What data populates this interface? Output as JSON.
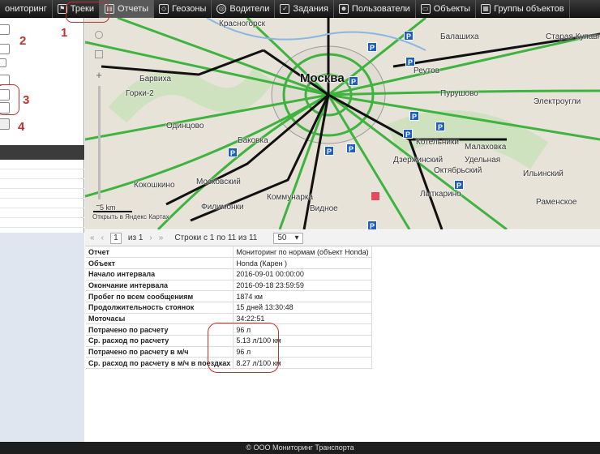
{
  "nav": [
    {
      "label": "ониторинг",
      "icon": "monitor-icon"
    },
    {
      "label": "Треки",
      "icon": "flag-icon"
    },
    {
      "label": "Отчеты",
      "icon": "report-icon",
      "active": true
    },
    {
      "label": "Геозоны",
      "icon": "geozone-icon"
    },
    {
      "label": "Водители",
      "icon": "steering-wheel-icon"
    },
    {
      "label": "Задания",
      "icon": "task-icon"
    },
    {
      "label": "Пользователи",
      "icon": "user-icon"
    },
    {
      "label": "Объекты",
      "icon": "bus-icon"
    },
    {
      "label": "Группы объектов",
      "icon": "groups-icon"
    }
  ],
  "annotations": [
    "1",
    "2",
    "3",
    "4"
  ],
  "map": {
    "city": "Москва",
    "labels": [
      "Красногорск",
      "Балашиха",
      "Старая Купавна",
      "Реутов",
      "Электроугли",
      "Одинцово",
      "Пурушово",
      "Баковка",
      "Котельники",
      "Малаховка",
      "Дзержинский",
      "Удельная",
      "Лыткарино",
      "Ильинский",
      "Раменское",
      "Видное",
      "Коммунарка",
      "Кокошкино",
      "Московский",
      "Филимонки",
      "Горки-2",
      "Барвиха",
      "Октябрьский"
    ],
    "scale": "5 km",
    "open_link": "Открыть в Яндекс Картах"
  },
  "pager": {
    "page": "1",
    "of_pages": "из 1",
    "rows_info": "Строки с 1 по 11 из 11",
    "page_size": "50"
  },
  "report": [
    {
      "key": "Отчет",
      "value": "Мониторинг по нормам (объект Honda)"
    },
    {
      "key": "Объект",
      "value": "Honda (Карен )"
    },
    {
      "key": "Начало интервала",
      "value": "2016-09-01 00:00:00"
    },
    {
      "key": "Окончание интервала",
      "value": "2016-09-18 23:59:59"
    },
    {
      "key": "Пробег по всем сообщениям",
      "value": "1874 км"
    },
    {
      "key": "Продолжительность стоянок",
      "value": "15 дней 13:30:48"
    },
    {
      "key": "Моточасы",
      "value": "34:22:51"
    },
    {
      "key": "Потрачено по расчету",
      "value": "96 л"
    },
    {
      "key": "Ср. расход по расчету",
      "value": "5.13 л/100 км"
    },
    {
      "key": "Потрачено по расчету в м/ч",
      "value": "96 л"
    },
    {
      "key": "Ср. расход по расчету в м/ч в поездках",
      "value": "8.27 л/100 км"
    }
  ],
  "footer": "© ООО Мониторинг Транспорта"
}
